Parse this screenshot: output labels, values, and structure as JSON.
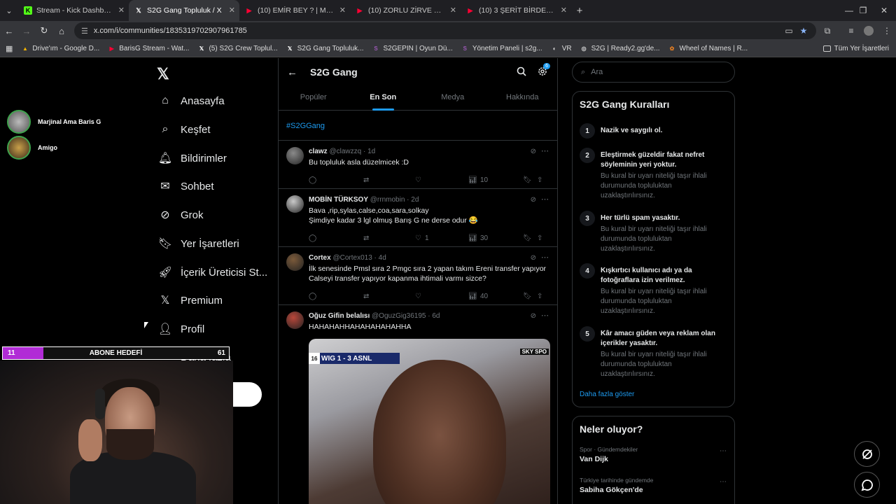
{
  "browser": {
    "tabs": [
      {
        "title": "Stream - Kick Dashboard",
        "icon": "kick-icon",
        "color": "#53fc18",
        "active": false
      },
      {
        "title": "S2G Gang Topluluk / X",
        "icon": "x-icon",
        "color": "#ffffff",
        "active": true
      },
      {
        "title": "(10) EMİR BEY ? | Madara Oldu",
        "icon": "youtube-icon",
        "color": "#ff0033",
        "active": false
      },
      {
        "title": "(10) ZORLU ZİRVE MAÇLARI! Hı",
        "icon": "youtube-icon",
        "color": "#ff0033",
        "active": false
      },
      {
        "title": "(10) 3 ŞERİT BİRDEN! Türkiye'd",
        "icon": "youtube-icon",
        "color": "#ff0033",
        "active": false
      }
    ],
    "url": "x.com/i/communities/1835319702907961785",
    "bookmarks": [
      {
        "label": "Drive'ım - Google D...",
        "icon": "drive-icon",
        "color": "#f4b400"
      },
      {
        "label": "BarisG Stream - Wat...",
        "icon": "youtube-icon",
        "color": "#ff0033"
      },
      {
        "label": "(5) S2G Crew Toplul...",
        "icon": "x-icon",
        "color": "#ffffff"
      },
      {
        "label": "S2G Gang Topluluk...",
        "icon": "x-icon",
        "color": "#ffffff"
      },
      {
        "label": "S2GEPIN | Oyun Dü...",
        "icon": "s2g-icon",
        "color": "#9b59b6"
      },
      {
        "label": "Yönetim Paneli | s2g...",
        "icon": "s2g-icon",
        "color": "#9b59b6"
      },
      {
        "label": "VR",
        "icon": "vr-icon",
        "color": "#dddddd"
      },
      {
        "label": "S2G | Ready2.gg'de...",
        "icon": "globe-icon",
        "color": "#dddddd"
      },
      {
        "label": "Wheel of Names | R...",
        "icon": "wheel-icon",
        "color": "#e67e22"
      }
    ],
    "all_bookmarks": "Tüm Yer İşaretleri"
  },
  "nav": {
    "items": [
      {
        "label": "Anasayfa",
        "icon": "home-icon"
      },
      {
        "label": "Keşfet",
        "icon": "search-icon"
      },
      {
        "label": "Bildirimler",
        "icon": "bell-icon"
      },
      {
        "label": "Sohbet",
        "icon": "mail-icon"
      },
      {
        "label": "Grok",
        "icon": "grok-icon"
      },
      {
        "label": "Yer İşaretleri",
        "icon": "bookmark-icon"
      },
      {
        "label": "İçerik Üreticisi St...",
        "icon": "rocket-icon"
      },
      {
        "label": "Premium",
        "icon": "x-icon"
      },
      {
        "label": "Profil",
        "icon": "person-icon"
      },
      {
        "label": "Daha fazla",
        "icon": "more-circle-icon"
      }
    ]
  },
  "feed": {
    "title": "S2G Gang",
    "notif_badge": "6",
    "tabs": [
      "Popüler",
      "En Son",
      "Medya",
      "Hakkında"
    ],
    "active_tab": "En Son",
    "hashtag": "#S2GGang",
    "tweets": [
      {
        "name": "clawz",
        "handle": "@clawzzq",
        "time": "1d",
        "text": [
          "Bu topluluk asla düzelmicek :D"
        ],
        "likes": "",
        "views": "10"
      },
      {
        "name": "MOBİN TÜRKSOY",
        "handle": "@rrnmobin",
        "time": "2d",
        "text": [
          "Bava ,rip,sylas,calse,coa,sara,solkay",
          "Şimdiye kadar 3 lgl olmuş Barış G ne derse odur 😂"
        ],
        "likes": "1",
        "views": "30"
      },
      {
        "name": "Cortex",
        "handle": "@Cortex013",
        "time": "4d",
        "text": [
          "İlk senesinde Pmsl sıra 2 Pmgc sıra 2 yapan takım Ereni transfer yapıyor",
          "Calseyi transfer yapıyor kapanma ihtimali varmı sizce?"
        ],
        "likes": "",
        "views": "40"
      },
      {
        "name": "Oğuz Gifin belalısı",
        "handle": "@OguzGig36195",
        "time": "6d",
        "text": [
          "HAHAHAHHAHAHAHAHAHHA"
        ],
        "media": {
          "score": "WIG 1 - 3 ASNL",
          "minute": "16",
          "broadcaster": "SKY SPO"
        }
      }
    ]
  },
  "right": {
    "search_placeholder": "Ara",
    "rules_title": "S2G Gang Kuralları",
    "rules": [
      {
        "num": "1",
        "title": "Nazik ve saygılı ol.",
        "desc": ""
      },
      {
        "num": "2",
        "title": "Eleştirmek güzeldir fakat nefret söyleminin yeri yoktur.",
        "desc": "Bu kural bir uyarı niteliği taşır ihlali durumunda topluluktan uzaklaştırılırsınız."
      },
      {
        "num": "3",
        "title": "Her türlü spam yasaktır.",
        "desc": "Bu kural bir uyarı niteliği taşır ihlali durumunda topluluktan uzaklaştırılırsınız."
      },
      {
        "num": "4",
        "title": "Kışkırtıcı kullanıcı adı ya da fotoğraflara izin verilmez.",
        "desc": "Bu kural bir uyarı niteliği taşır ihlali durumunda topluluktan uzaklaştırılırsınız."
      },
      {
        "num": "5",
        "title": "Kâr amacı güden veya reklam olan içerikler yasaktır.",
        "desc": "Bu kural bir uyarı niteliği taşır ihlali durumunda topluluktan uzaklaştırılırsınız."
      }
    ],
    "show_more": "Daha fazla göster",
    "trends_title": "Neler oluyor?",
    "trends": [
      {
        "category": "Spor · Gündemdekiler",
        "name": "Van Dijk"
      },
      {
        "category": "Türkiye tarihinde gündemde",
        "name": "Sabiha Gökçen'de"
      }
    ]
  },
  "overlay": {
    "viewers": [
      {
        "name": "Marjinal Ama Baris G"
      },
      {
        "name": "Amigo"
      }
    ],
    "goal": {
      "current": "11",
      "label": "ABONE HEDEFİ",
      "target": "61",
      "progress": 0.18,
      "color": "#b12bd6"
    }
  }
}
